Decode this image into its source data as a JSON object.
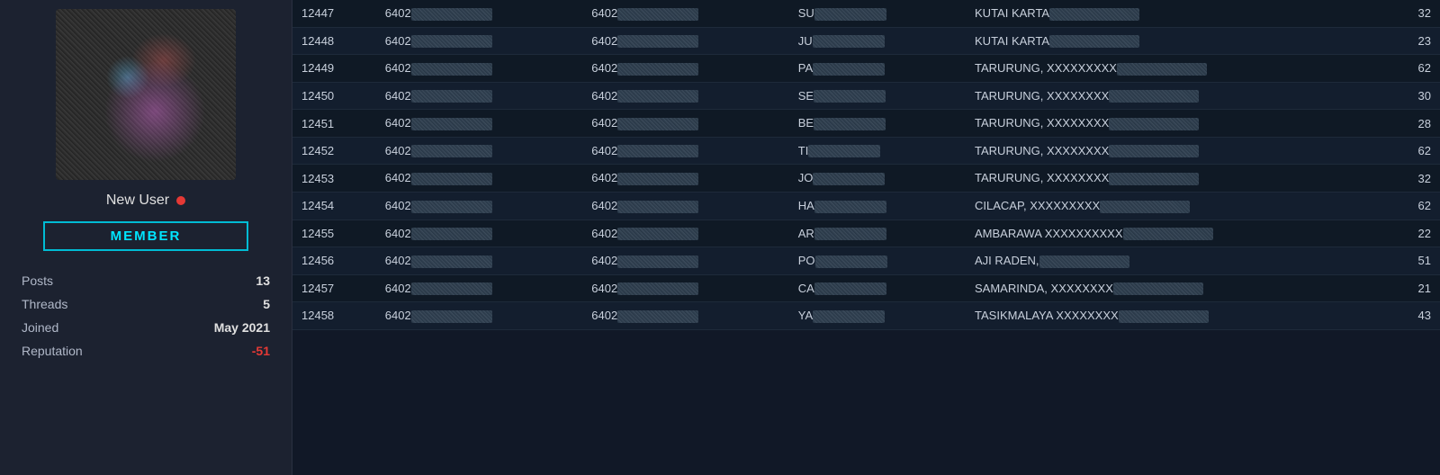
{
  "sidebar": {
    "username": "New User",
    "online_status": "offline",
    "badge": "MEMBER",
    "stats": {
      "posts_label": "Posts",
      "posts_value": "13",
      "threads_label": "Threads",
      "threads_value": "5",
      "joined_label": "Joined",
      "joined_value": "May 2021",
      "reputation_label": "Reputation",
      "reputation_value": "-51"
    }
  },
  "table": {
    "rows": [
      {
        "num": "12447",
        "col1": "6402XXXXXXXX",
        "col2": "6402XXXXXXXX",
        "col3": "SU_XXXXX",
        "col4": "KUTAI KARTA XXXXXXXXX",
        "col5": "32"
      },
      {
        "num": "12448",
        "col1": "6402XXXXXXXX",
        "col2": "6402XXXXXXXX",
        "col3": "JU_XXXXX",
        "col4": "KUTAI KARTA XXXXXXXXX",
        "col5": "23"
      },
      {
        "num": "12449",
        "col1": "6402XXXXXXXX",
        "col2": "6402XXXXXXXX",
        "col3": "PA_XXXXXXXXX",
        "col4": "TARURUNG, XXXXXXXXX",
        "col5": "62"
      },
      {
        "num": "12450",
        "col1": "6402XXXXXXXX",
        "col2": "6402XXXXXXXX",
        "col3": "SE_XXXXXXXXX",
        "col4": "TARURUNG, XXXXXXXX",
        "col5": "30"
      },
      {
        "num": "12451",
        "col1": "6402XXXXXXXX",
        "col2": "6402XXXXXXXX",
        "col3": "BE_XXXXXXXXX",
        "col4": "TARURUNG, XXXXXXXX",
        "col5": "28"
      },
      {
        "num": "12452",
        "col1": "6402XXXXXXXX",
        "col2": "6402XXXXXXXX",
        "col3": "TI_XXXXXXXXX",
        "col4": "TARURUNG, XXXXXXXX",
        "col5": "62"
      },
      {
        "num": "12453",
        "col1": "6402XXXXXXXX",
        "col2": "6402XXXXXXXX",
        "col3": "JO_XXXXXXXXX",
        "col4": "TARURUNG, XXXXXXXX",
        "col5": "32"
      },
      {
        "num": "12454",
        "col1": "6402XXXXXXXX",
        "col2": "6402XXXXXXXX",
        "col3": "HA_XXXXX",
        "col4": "CILACAP, XXXXXXXXX",
        "col5": "62"
      },
      {
        "num": "12455",
        "col1": "6402XXXXXXXX",
        "col2": "6402XXXXXXXX",
        "col3": "AR_XXXXX",
        "col4": "AMBARAWA XXXXXXXXXX",
        "col5": "22"
      },
      {
        "num": "12456",
        "col1": "6402XXXXXXXX",
        "col2": "6402XXXXXXXX",
        "col3": "PO_XXXXX",
        "col4": "AJI RADEN, XXXXXXXXX",
        "col5": "51"
      },
      {
        "num": "12457",
        "col1": "6402XXXXXXXX",
        "col2": "6402XXXXXXXX",
        "col3": "CA_XXXXXXXXX",
        "col4": "SAMARINDA, XXXXXXXX",
        "col5": "21"
      },
      {
        "num": "12458",
        "col1": "6402XXXXXXXX",
        "col2": "6402XXXXXXXX",
        "col3": "YA_XXXXX",
        "col4": "TASIKMALAYA XXXXXXXX",
        "col5": "43"
      }
    ]
  }
}
